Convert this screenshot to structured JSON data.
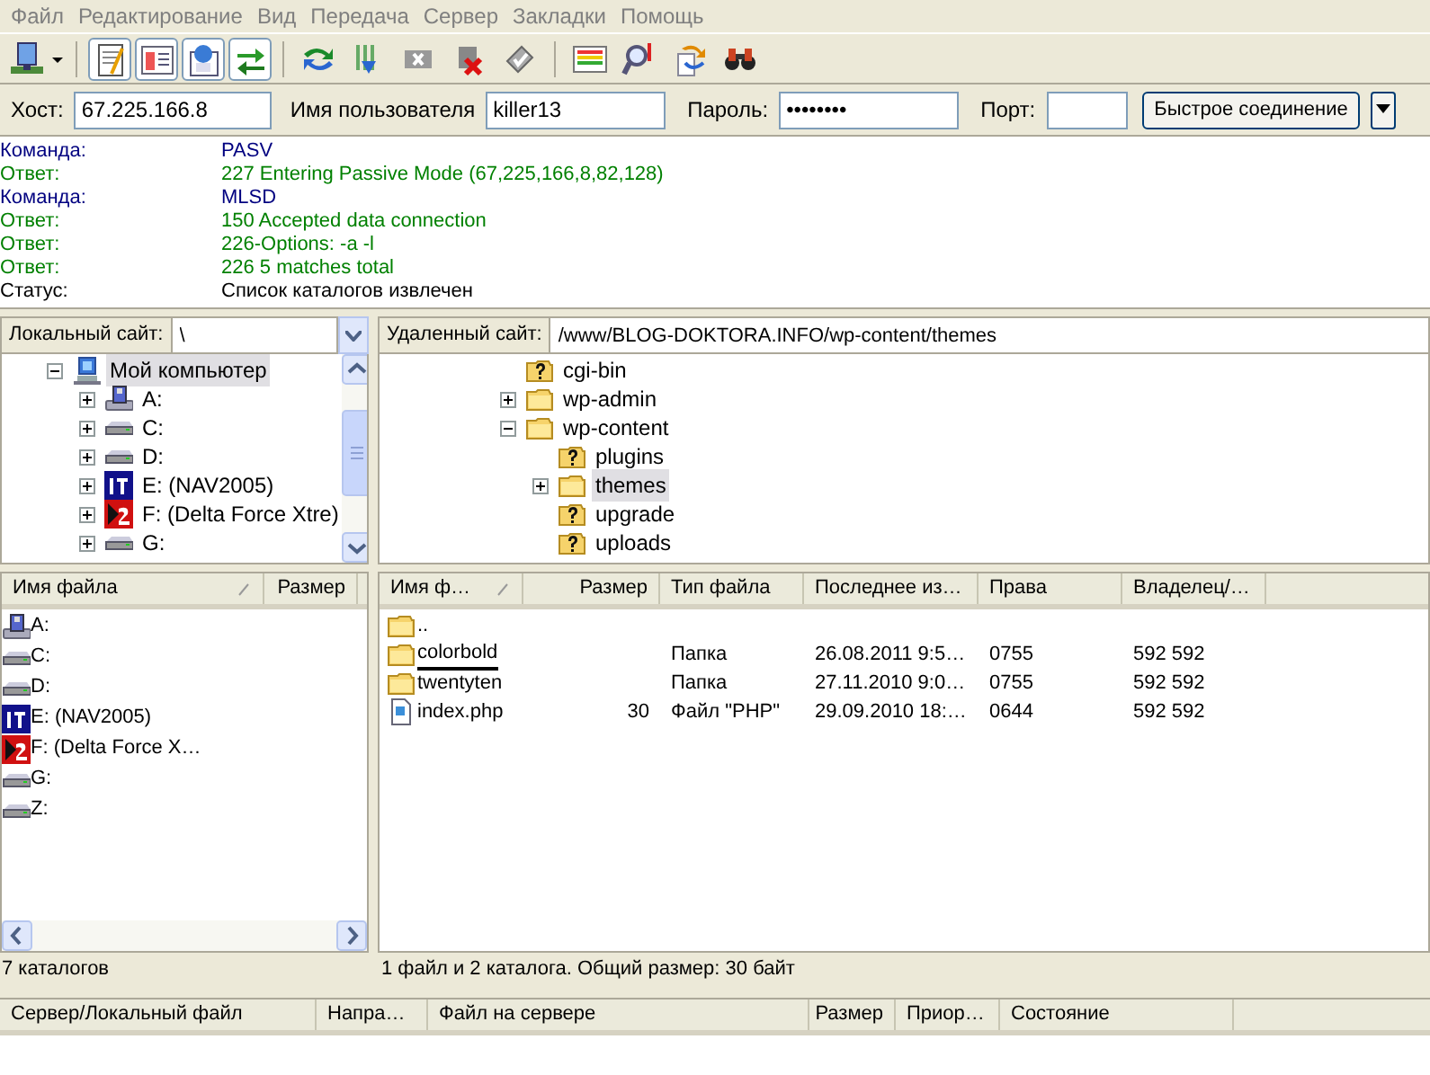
{
  "menu": [
    "Файл",
    "Редактирование",
    "Вид",
    "Передача",
    "Сервер",
    "Закладки",
    "Помощь"
  ],
  "toolbar": {
    "toggles": [
      {
        "pressed": true
      },
      {
        "pressed": true
      },
      {
        "pressed": true
      },
      {
        "pressed": true
      }
    ]
  },
  "quickconnect": {
    "host_label": "Хост:",
    "host": "67.225.166.8",
    "user_label": "Имя пользователя",
    "user": "killer13",
    "pass_label": "Пароль:",
    "pass": "••••••••",
    "port_label": "Порт:",
    "button": "Быстрое соединение"
  },
  "log": [
    {
      "kind": "command",
      "label": "Команда:",
      "text": "PASV"
    },
    {
      "kind": "response",
      "label": "Ответ:",
      "text": "227 Entering Passive Mode (67,225,166,8,82,128)"
    },
    {
      "kind": "command",
      "label": "Команда:",
      "text": "MLSD"
    },
    {
      "kind": "response",
      "label": "Ответ:",
      "text": "150 Accepted data connection"
    },
    {
      "kind": "response",
      "label": "Ответ:",
      "text": "226-Options: -a -l"
    },
    {
      "kind": "response",
      "label": "Ответ:",
      "text": "226 5 matches total"
    },
    {
      "kind": "status",
      "label": "Статус:",
      "text": "Список каталогов извлечен"
    }
  ],
  "local_site": {
    "label": "Локальный сайт:",
    "path": "\\"
  },
  "remote_site": {
    "label": "Удаленный сайт:",
    "path": "/www/BLOG-DOKTORA.INFO/wp-content/themes"
  },
  "local_tree": [
    {
      "kind": "computer",
      "name": "Мой компьютер",
      "expanded": true,
      "selected": true,
      "children": [
        {
          "kind": "floppy",
          "name": "A:",
          "expanded": false,
          "selected": false
        },
        {
          "kind": "drive",
          "name": "C:",
          "expanded": false,
          "selected": false
        },
        {
          "kind": "drive",
          "name": "D:",
          "expanded": false,
          "selected": false
        },
        {
          "kind": "disc_blue",
          "name": "E: (NAV2005)",
          "expanded": false,
          "selected": false
        },
        {
          "kind": "disc_red",
          "name": "F: (Delta Force Xtre)",
          "expanded": false,
          "selected": false
        },
        {
          "kind": "drive",
          "name": "G:",
          "expanded": false,
          "selected": false
        }
      ]
    }
  ],
  "remote_tree": [
    {
      "kind": "unknown_folder",
      "name": "cgi-bin",
      "selected": false
    },
    {
      "kind": "folder",
      "name": "wp-admin",
      "expanded": false,
      "selected": false
    },
    {
      "kind": "folder",
      "name": "wp-content",
      "expanded": true,
      "selected": false,
      "children": [
        {
          "kind": "unknown_folder",
          "name": "plugins",
          "selected": false
        },
        {
          "kind": "folder",
          "name": "themes",
          "expanded": false,
          "selected": true
        },
        {
          "kind": "unknown_folder",
          "name": "upgrade",
          "selected": false
        },
        {
          "kind": "unknown_folder",
          "name": "uploads",
          "selected": false
        }
      ]
    }
  ],
  "local_files": {
    "columns": [
      "Имя файла",
      "Размер"
    ],
    "rows": [
      {
        "kind": "floppy",
        "name": "A:"
      },
      {
        "kind": "drive",
        "name": "C:"
      },
      {
        "kind": "drive",
        "name": "D:"
      },
      {
        "kind": "disc_blue",
        "name": "E: (NAV2005)"
      },
      {
        "kind": "disc_red",
        "name": "F: (Delta Force X…"
      },
      {
        "kind": "drive",
        "name": "G:"
      },
      {
        "kind": "drive",
        "name": "Z:"
      }
    ],
    "status": "7 каталогов"
  },
  "remote_files": {
    "columns": [
      "Имя ф…",
      "Размер",
      "Тип файла",
      "Последнее из…",
      "Права",
      "Владелец/…"
    ],
    "rows": [
      {
        "kind": "folder",
        "focused": false,
        "cells": [
          "..",
          "",
          "",
          "",
          "",
          ""
        ]
      },
      {
        "kind": "folder",
        "focused": true,
        "cells": [
          "colorbold",
          "",
          "Папка",
          "26.08.2011 9:5…",
          "0755",
          "592 592"
        ]
      },
      {
        "kind": "folder",
        "focused": false,
        "cells": [
          "twentyten",
          "",
          "Папка",
          "27.11.2010 9:0…",
          "0755",
          "592 592"
        ]
      },
      {
        "kind": "file",
        "focused": false,
        "cells": [
          "index.php",
          "30",
          "Файл \"PHP\"",
          "29.09.2010 18:…",
          "0644",
          "592 592"
        ]
      }
    ],
    "status": "1 файл и 2 каталога. Общий размер: 30 байт"
  },
  "queue": {
    "columns": [
      "Сервер/Локальный файл",
      "Напра…",
      "Файл на сервере",
      "Размер",
      "Приор…",
      "Состояние"
    ]
  }
}
